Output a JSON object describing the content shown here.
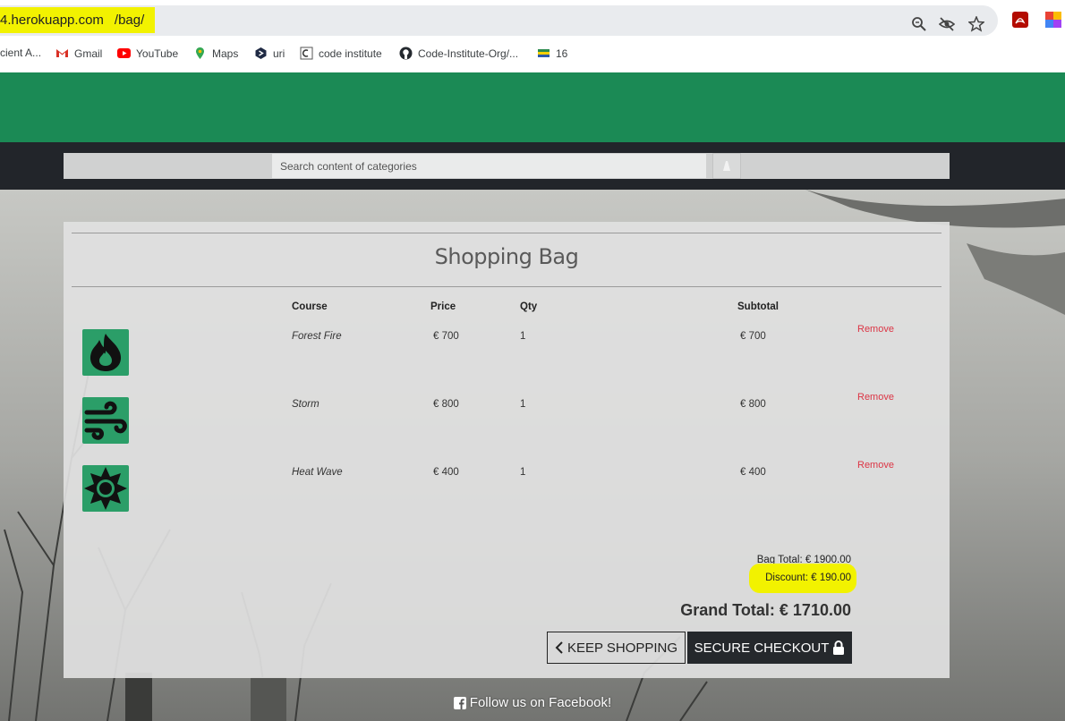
{
  "browser": {
    "url_prefix": "4.herokuapp.com",
    "url_path": "/bag/",
    "bookmarks": [
      {
        "label": "cient A...",
        "icon": "none"
      },
      {
        "label": "Gmail",
        "icon": "gmail-icon"
      },
      {
        "label": "YouTube",
        "icon": "youtube-icon"
      },
      {
        "label": "Maps",
        "icon": "maps-icon"
      },
      {
        "label": "uri",
        "icon": "uri-icon"
      },
      {
        "label": "code institute",
        "icon": "code-institute-icon"
      },
      {
        "label": "Code-Institute-Org/...",
        "icon": "github-icon"
      },
      {
        "label": "16",
        "icon": "flag-icon"
      }
    ]
  },
  "search": {
    "placeholder": "Search content of categories"
  },
  "bag": {
    "title": "Shopping Bag",
    "headers": {
      "course": "Course",
      "price": "Price",
      "qty": "Qty",
      "subtotal": "Subtotal"
    },
    "items": [
      {
        "course": "Forest Fire",
        "price": "€ 700",
        "qty": "1",
        "subtotal": "€ 700",
        "remove": "Remove",
        "icon": "fire-icon"
      },
      {
        "course": "Storm",
        "price": "€ 800",
        "qty": "1",
        "subtotal": "€ 800",
        "remove": "Remove",
        "icon": "wind-icon"
      },
      {
        "course": "Heat Wave",
        "price": "€ 400",
        "qty": "1",
        "subtotal": "€ 400",
        "remove": "Remove",
        "icon": "sun-icon"
      }
    ],
    "bag_total": "Bag Total:  € 1900.00",
    "discount": "Discount:  € 190.00",
    "grand_total": "Grand Total:  € 1710.00",
    "keep_shopping": "KEEP SHOPPING",
    "secure_checkout": "SECURE CHECKOUT"
  },
  "footer": {
    "text": "Follow us on Facebook!"
  },
  "colors": {
    "brand_green": "#1b8a55",
    "dark": "#22252a",
    "remove": "#dc3545",
    "highlight": "#f2f200"
  }
}
